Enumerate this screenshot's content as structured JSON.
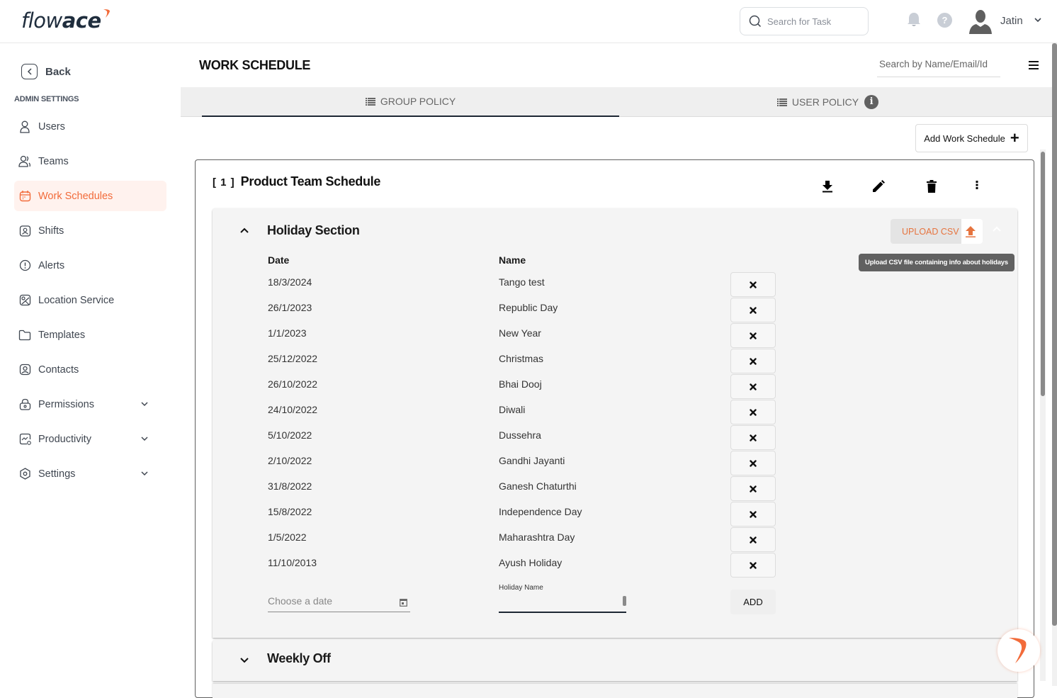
{
  "app": {
    "logo_light": "flow",
    "logo_bold": "ace",
    "brand_color": "#f26b3a"
  },
  "topbar": {
    "task_search_placeholder": "Search for Task",
    "user_name": "Jatin",
    "icons": [
      "search-icon",
      "bell-icon",
      "help-icon",
      "avatar-icon",
      "chevron-down-icon"
    ]
  },
  "sidebar": {
    "back_label": "Back",
    "section_title": "ADMIN SETTINGS",
    "items": [
      {
        "label": "Users",
        "icon": "user-icon",
        "active": false,
        "expandable": false
      },
      {
        "label": "Teams",
        "icon": "team-icon",
        "active": false,
        "expandable": false
      },
      {
        "label": "Work Schedules",
        "icon": "calendar-icon",
        "active": true,
        "expandable": false
      },
      {
        "label": "Shifts",
        "icon": "shift-icon",
        "active": false,
        "expandable": false
      },
      {
        "label": "Alerts",
        "icon": "alert-icon",
        "active": false,
        "expandable": false
      },
      {
        "label": "Location Service",
        "icon": "location-icon",
        "active": false,
        "expandable": false
      },
      {
        "label": "Templates",
        "icon": "folder-icon",
        "active": false,
        "expandable": false
      },
      {
        "label": "Contacts",
        "icon": "contact-icon",
        "active": false,
        "expandable": false
      },
      {
        "label": "Permissions",
        "icon": "lock-icon",
        "active": false,
        "expandable": true
      },
      {
        "label": "Productivity",
        "icon": "productivity-icon",
        "active": false,
        "expandable": true
      },
      {
        "label": "Settings",
        "icon": "settings-icon",
        "active": false,
        "expandable": true
      }
    ]
  },
  "main": {
    "page_title": "WORK SCHEDULE",
    "name_search_placeholder": "Search by Name/Email/Id",
    "tabs": [
      {
        "label": "GROUP POLICY",
        "active": true
      },
      {
        "label": "USER POLICY",
        "active": false,
        "info": "i"
      }
    ],
    "add_button_label": "Add Work Schedule",
    "add_button_icon": "+",
    "schedule": {
      "index": "[ 1 ]",
      "title": "Product Team Schedule",
      "actions": [
        "download-icon",
        "edit-icon",
        "delete-icon",
        "more-icon"
      ],
      "holiday_section": {
        "title": "Holiday Section",
        "upload_label": "UPLOAD CSV",
        "upload_tooltip": "Upload CSV file containing info about holidays",
        "columns": {
          "date": "Date",
          "name": "Name"
        },
        "delete_glyph": "✖",
        "rows": [
          {
            "date": "18/3/2024",
            "name": "Tango test"
          },
          {
            "date": "26/1/2023",
            "name": "Republic Day"
          },
          {
            "date": "1/1/2023",
            "name": "New Year"
          },
          {
            "date": "25/12/2022",
            "name": "Christmas"
          },
          {
            "date": "26/10/2022",
            "name": "Bhai Dooj"
          },
          {
            "date": "24/10/2022",
            "name": "Diwali"
          },
          {
            "date": "5/10/2022",
            "name": "Dussehra"
          },
          {
            "date": "2/10/2022",
            "name": "Gandhi Jayanti"
          },
          {
            "date": "31/8/2022",
            "name": "Ganesh Chaturthi"
          },
          {
            "date": "15/8/2022",
            "name": "Independence Day"
          },
          {
            "date": "1/5/2022",
            "name": "Maharashtra Day"
          },
          {
            "date": "11/10/2013",
            "name": "Ayush Holiday"
          }
        ],
        "date_placeholder": "Choose a date",
        "holiday_name_label": "Holiday Name",
        "holiday_name_value": "",
        "add_label": "ADD"
      },
      "weekly_off": {
        "title": "Weekly Off"
      }
    }
  }
}
